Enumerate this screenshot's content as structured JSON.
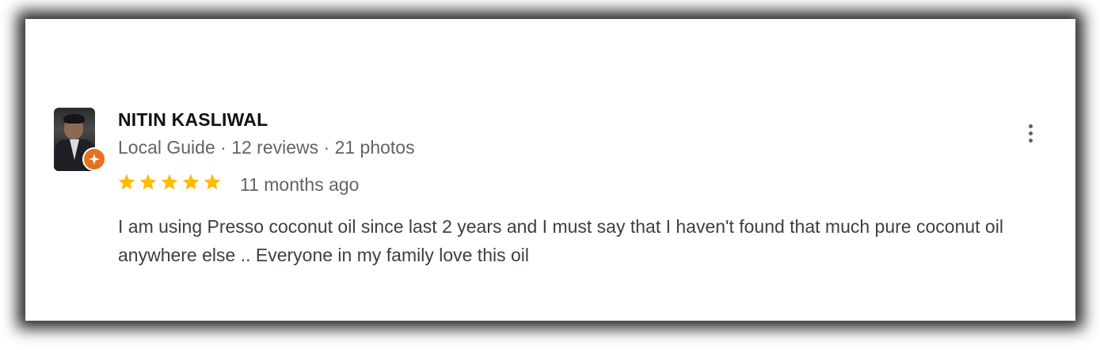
{
  "review": {
    "reviewer_name": "NITIN KASLIWAL",
    "reviewer_meta": "Local Guide · 12 reviews · 21 photos",
    "rating": 5,
    "rating_max": 5,
    "time_ago": "11 months ago",
    "text": "I am using Presso coconut oil since last 2 years and I must say that I haven't found that much pure coconut oil anywhere else .. Everyone in my family love this oil"
  },
  "icons": {
    "avatar": "reviewer-photo",
    "badge": "local-guide-badge-icon",
    "star": "star-icon",
    "more": "more-vert-icon"
  },
  "colors": {
    "star": "#fbbc04",
    "badge": "#e8711e",
    "name": "#111111",
    "meta": "#60646a",
    "text": "#3c4043"
  }
}
